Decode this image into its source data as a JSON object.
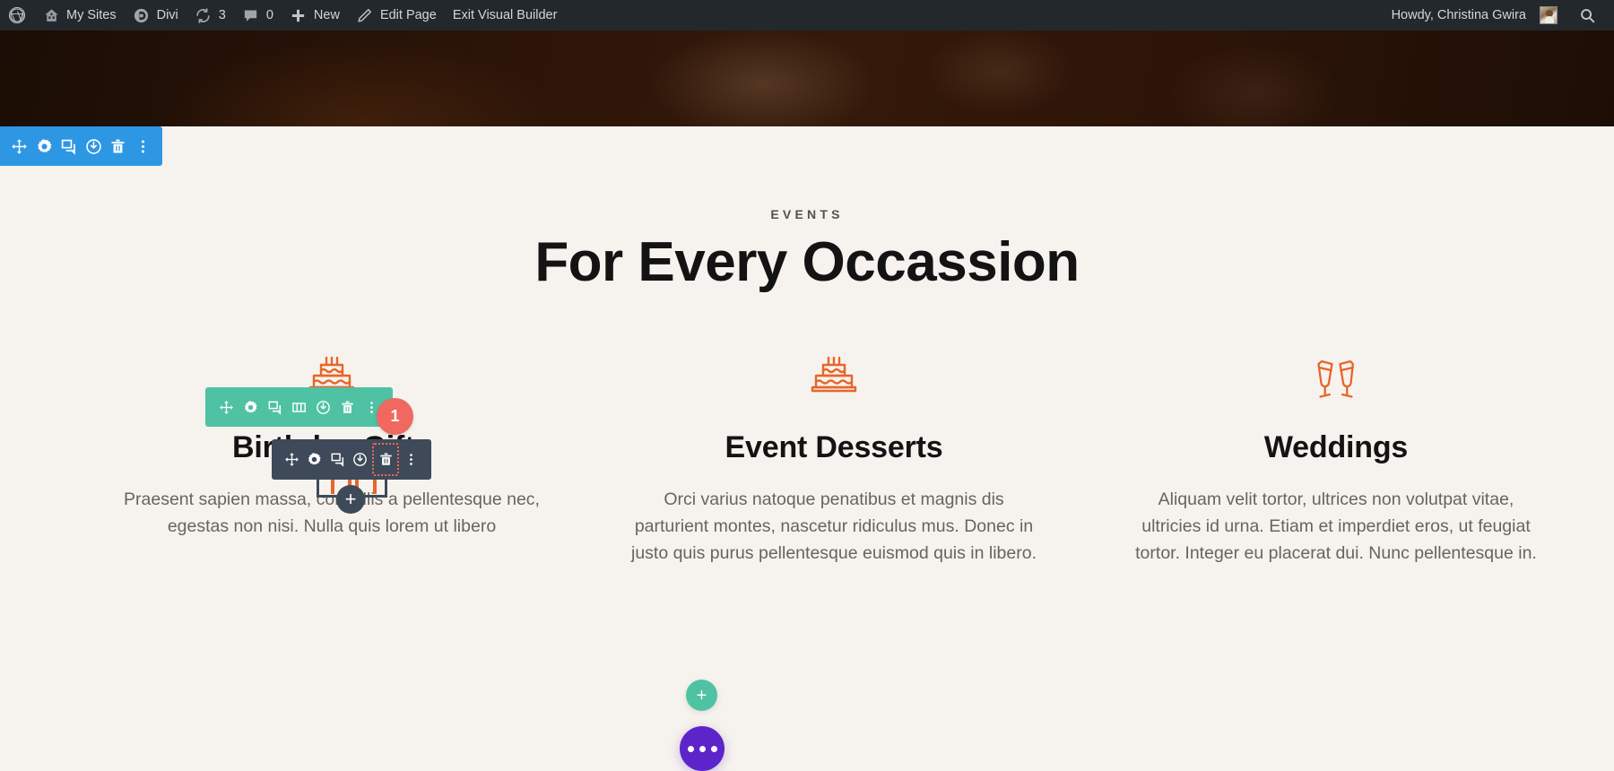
{
  "adminbar": {
    "items": [
      {
        "id": "wp-logo",
        "icon": "wordpress-icon",
        "label": ""
      },
      {
        "id": "my-sites",
        "icon": "sites-icon",
        "label": "My Sites"
      },
      {
        "id": "divi",
        "icon": "divi-icon",
        "label": "Divi"
      },
      {
        "id": "updates",
        "icon": "updates-icon",
        "label": "3"
      },
      {
        "id": "comments",
        "icon": "comment-icon",
        "label": "0"
      },
      {
        "id": "new",
        "icon": "plus-icon",
        "label": "New"
      },
      {
        "id": "edit-page",
        "icon": "pencil-icon",
        "label": "Edit Page"
      },
      {
        "id": "exit-vb",
        "icon": "",
        "label": "Exit Visual Builder"
      }
    ],
    "howdy": "Howdy, Christina Gwira",
    "search_icon": "search-icon",
    "bg_color": "#23282d"
  },
  "section": {
    "eyebrow": "EVENTS",
    "title": "For Every Occassion"
  },
  "columns": [
    {
      "icon": "birthday-cake-icon",
      "title": "Birthday Gifts",
      "body": "Praesent sapien massa, convallis a pellentesque nec, egestas non nisi. Nulla quis lorem ut libero"
    },
    {
      "icon": "birthday-cake-icon",
      "title": "Event Desserts",
      "body": "Orci varius natoque penatibus et magnis dis parturient montes, nascetur ridiculus mus. Donec in justo quis purus pellentesque euismod quis in libero."
    },
    {
      "icon": "champagne-toast-icon",
      "title": "Weddings",
      "body": "Aliquam velit tortor, ultrices non volutpat vitae, ultricies id urna. Etiam et imperdiet eros, ut feugiat tortor. Integer eu placerat dui. Nunc pellentesque in."
    }
  ],
  "section_toolbar": {
    "color": "#2d97e4",
    "icons": [
      "move-icon",
      "gear-icon",
      "duplicate-icon",
      "power-icon",
      "trash-icon",
      "more-vertical-icon"
    ]
  },
  "row_toolbar": {
    "color": "#4fc2a3",
    "icons": [
      "move-icon",
      "gear-icon",
      "duplicate-icon",
      "columns-icon",
      "power-icon",
      "trash-icon",
      "more-vertical-icon"
    ],
    "badge": "1",
    "badge_color": "#f0685f"
  },
  "module_toolbar": {
    "color": "#3e4a59",
    "icons": [
      "move-icon",
      "gear-icon",
      "duplicate-icon",
      "power-icon",
      "trash-icon",
      "more-vertical-icon"
    ],
    "highlighted_icon": "trash-icon",
    "highlight_color": "#f0685f"
  },
  "buttons": {
    "module_add": "+",
    "add_row": "+",
    "fab": "more-horizontal-icon",
    "fab_color": "#5d24c9",
    "add_row_color": "#4fc2a3"
  },
  "theme": {
    "canvas_bg": "#f6f3ee",
    "accent_orange": "#e8652a",
    "heading_color": "#131313",
    "body_color": "#666463"
  }
}
